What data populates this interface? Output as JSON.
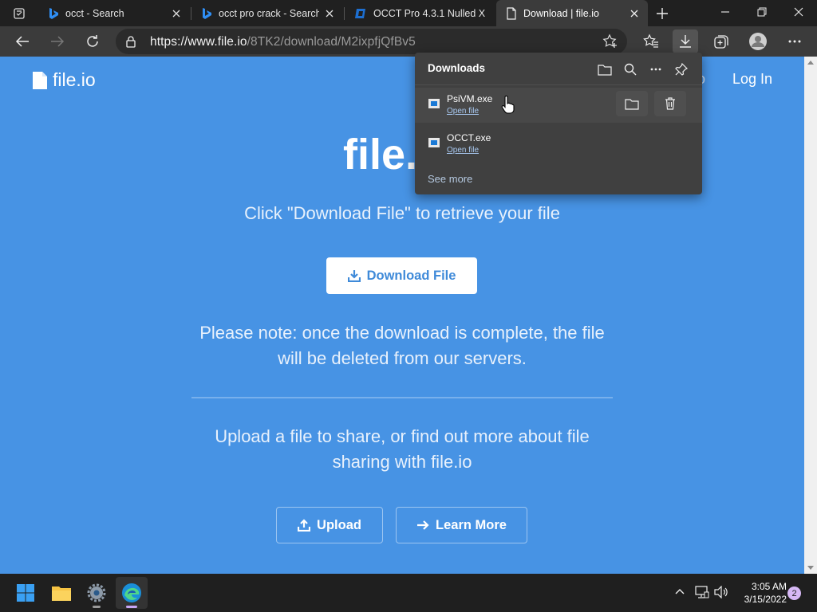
{
  "browser": {
    "tabs": [
      {
        "title": "occt - Search",
        "icon": "bing-icon",
        "active": false
      },
      {
        "title": "occt pro crack - Search",
        "icon": "bing-icon",
        "active": false
      },
      {
        "title": "OCCT Pro 4.3.1 Nulled X",
        "icon": "occt-icon",
        "active": false
      },
      {
        "title": "Download | file.io",
        "icon": "page-icon",
        "active": true
      }
    ],
    "address": {
      "host": "https://www.file.io",
      "path": "/8TK2/download/M2ixpfjQfBv5"
    }
  },
  "downloads_panel": {
    "title": "Downloads",
    "items": [
      {
        "filename": "PsiVM.exe",
        "action": "Open file"
      },
      {
        "filename": "OCCT.exe",
        "action": "Open file"
      }
    ],
    "see_more": "See more"
  },
  "site": {
    "logo": "file.io",
    "login": "Log In",
    "login_partial": "o",
    "hero_title": "file.",
    "subtitle": "Click \"Download File\" to retrieve your file",
    "download_button": "Download File",
    "note": "Please note: once the download is complete, the file will be deleted from our servers.",
    "upload_text": "Upload a file to share, or find out more about file sharing with file.io",
    "upload_button": "Upload",
    "learn_more_button": "Learn More"
  },
  "taskbar": {
    "time": "3:05 AM",
    "date": "3/15/2022",
    "notifications": "2"
  },
  "colors": {
    "page_bg": "#4793e4",
    "chrome_dark": "#202020",
    "toolbar": "#3b3b3b",
    "flyout": "#404040"
  }
}
